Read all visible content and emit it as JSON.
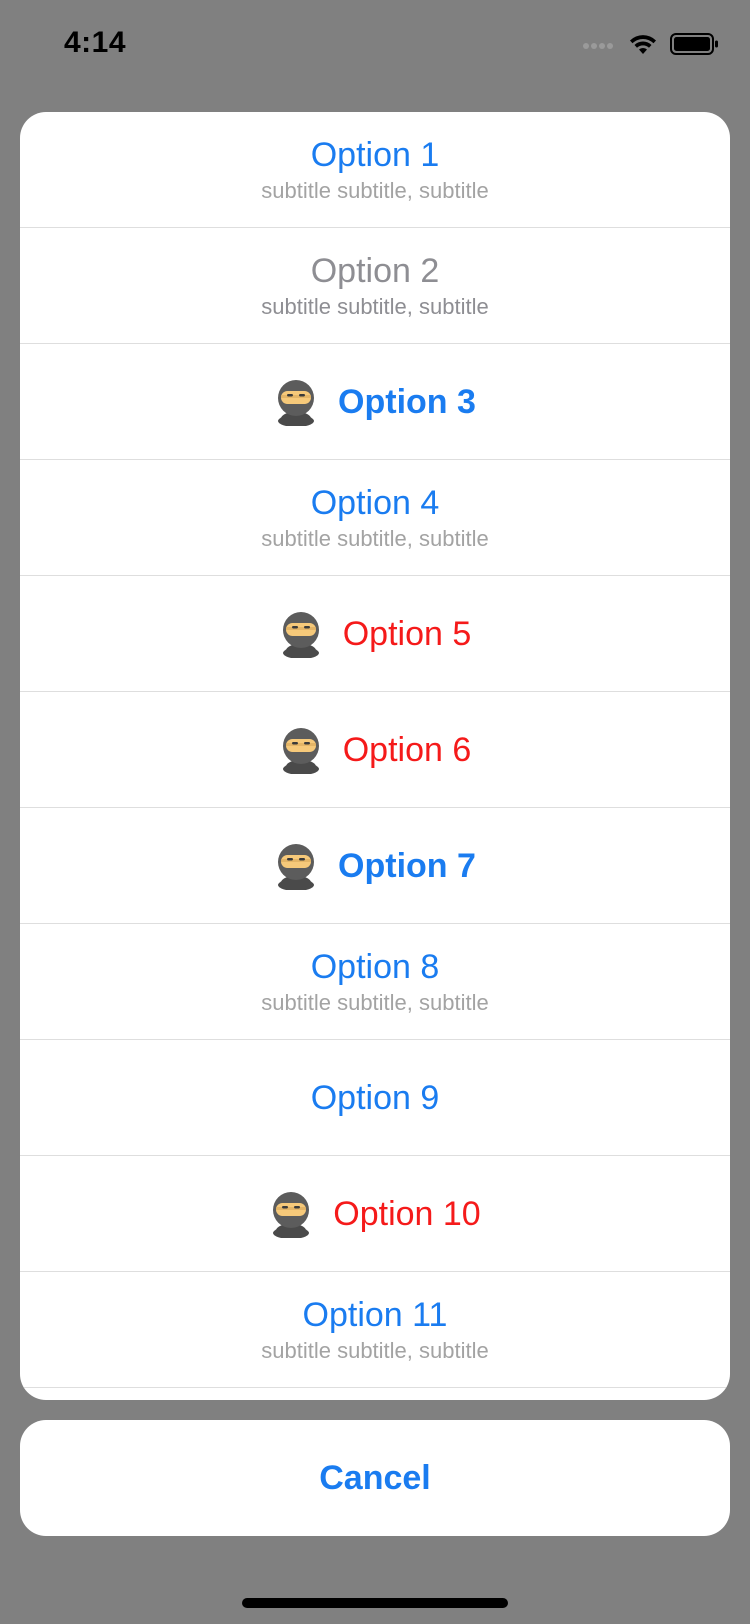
{
  "status_bar": {
    "time": "4:14",
    "icons": [
      "cellular-icon",
      "wifi-icon",
      "battery-icon"
    ]
  },
  "colors": {
    "blue": "#1a7cf0",
    "red": "#f51a1a",
    "gray": "#8e8e93",
    "subtitle": "#a3a3a3"
  },
  "options": [
    {
      "title": "Option 1",
      "subtitle": "subtitle subtitle, subtitle",
      "style": "default",
      "icon": null,
      "enabled": true
    },
    {
      "title": "Option 2",
      "subtitle": "subtitle subtitle, subtitle",
      "style": "default",
      "icon": null,
      "enabled": false
    },
    {
      "title": "Option 3",
      "subtitle": null,
      "style": "bold",
      "icon": "ninja-icon",
      "enabled": true
    },
    {
      "title": "Option 4",
      "subtitle": "subtitle subtitle, subtitle",
      "style": "default",
      "icon": null,
      "enabled": true
    },
    {
      "title": "Option 5",
      "subtitle": null,
      "style": "destructive",
      "icon": "ninja-icon",
      "enabled": true
    },
    {
      "title": "Option 6",
      "subtitle": null,
      "style": "destructive",
      "icon": "ninja-icon",
      "enabled": true
    },
    {
      "title": "Option 7",
      "subtitle": null,
      "style": "bold",
      "icon": "ninja-icon",
      "enabled": true
    },
    {
      "title": "Option 8",
      "subtitle": "subtitle subtitle, subtitle",
      "style": "default",
      "icon": null,
      "enabled": true
    },
    {
      "title": "Option 9",
      "subtitle": null,
      "style": "default",
      "icon": null,
      "enabled": true
    },
    {
      "title": "Option 10",
      "subtitle": null,
      "style": "destructive",
      "icon": "ninja-icon",
      "enabled": true
    },
    {
      "title": "Option 11",
      "subtitle": "subtitle subtitle, subtitle",
      "style": "default",
      "icon": null,
      "enabled": true
    }
  ],
  "cancel": {
    "label": "Cancel"
  }
}
